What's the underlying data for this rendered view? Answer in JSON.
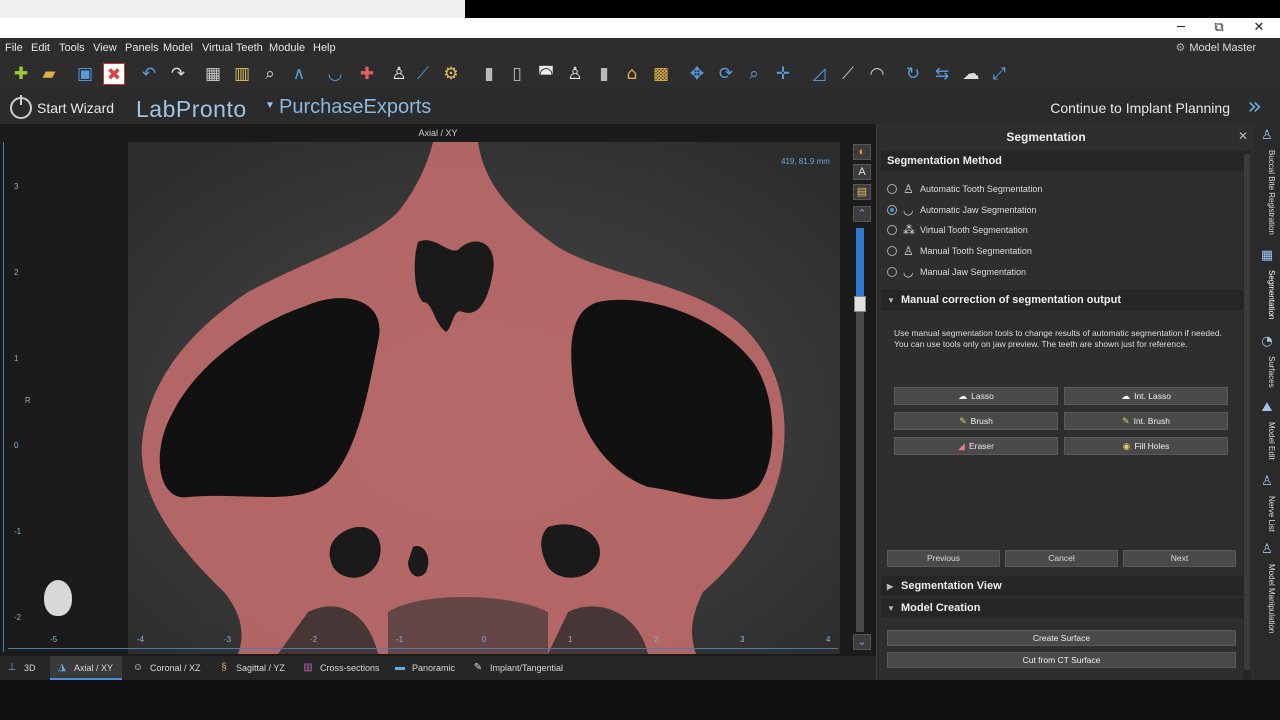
{
  "window": {
    "minimize": "─",
    "maximize": "⧉",
    "close": "✕"
  },
  "menu": {
    "items": [
      "File",
      "Edit",
      "Tools",
      "View",
      "Panels",
      "Model",
      "Virtual Teeth",
      "Module",
      "Help"
    ],
    "mode_label": "Model Master"
  },
  "wizard": {
    "start_label": "Start Wizard",
    "brand": "LabPronto",
    "brand_secondary": "PurchaseExports",
    "continue_label": "Continue to Implant Planning"
  },
  "viewport": {
    "title": "Axial / XY",
    "readout": "419, 81.9 mm",
    "orientation_label": "R",
    "vertical_ticks": [
      "3",
      "2",
      "1",
      "0",
      "-1",
      "-2"
    ],
    "horizontal_ticks": [
      "-5",
      "-4",
      "-3",
      "-2",
      "-1",
      "0",
      "1",
      "2",
      "3",
      "4"
    ],
    "slice_position": 0.17
  },
  "view_tabs": [
    {
      "label": "3D",
      "active": false
    },
    {
      "label": "Axial / XY",
      "active": true
    },
    {
      "label": "Coronal / XZ",
      "active": false
    },
    {
      "label": "Sagittal / YZ",
      "active": false
    },
    {
      "label": "Cross-sections",
      "active": false
    },
    {
      "label": "Panoramic",
      "active": false
    },
    {
      "label": "Implant/Tangential",
      "active": false
    }
  ],
  "panel": {
    "title": "Segmentation",
    "method_header": "Segmentation Method",
    "methods": [
      {
        "label": "Automatic Tooth Segmentation",
        "selected": false
      },
      {
        "label": "Automatic Jaw Segmentation",
        "selected": true
      },
      {
        "label": "Virtual Tooth Segmentation",
        "selected": false
      },
      {
        "label": "Manual Tooth Segmentation",
        "selected": false
      },
      {
        "label": "Manual Jaw Segmentation",
        "selected": false
      }
    ],
    "manual_header": "Manual correction of segmentation output",
    "description_line1": "Use manual segmentation tools to change results of automatic segmentation if needed.",
    "description_line2": "You can use tools only on jaw preview. The teeth are shown just for reference.",
    "tools": {
      "lasso": "Lasso",
      "int_lasso": "Int. Lasso",
      "brush": "Brush",
      "int_brush": "Int. Brush",
      "eraser": "Eraser",
      "fill_holes": "Fill Holes"
    },
    "nav": {
      "previous": "Previous",
      "cancel": "Cancel",
      "next": "Next"
    },
    "view_header": "Segmentation View",
    "model_header": "Model Creation",
    "create_surface": "Create Surface",
    "cut_surface": "Cut from CT Surface"
  },
  "right_tabs": [
    "Buccal Bite Registration",
    "Segmentation",
    "Surfaces",
    "Model Edit",
    "Nerve List",
    "Model Manipulation"
  ],
  "colors": {
    "accent": "#4a90d9",
    "segmentation": "#c96e6e",
    "brand": "#9ec4e6"
  }
}
